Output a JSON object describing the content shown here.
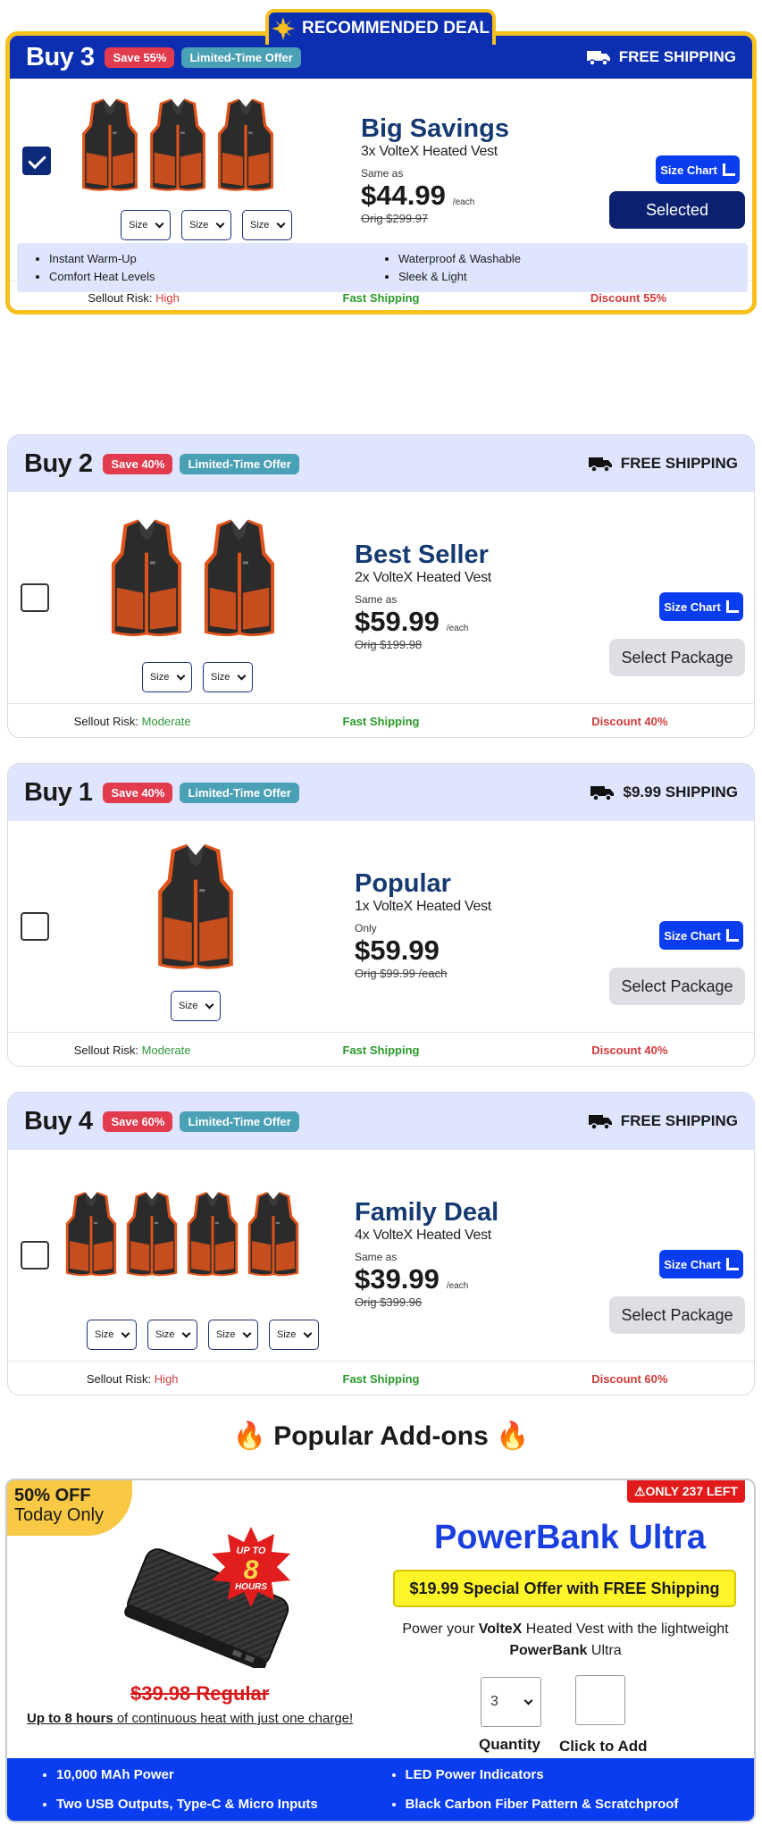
{
  "banner": {
    "label": "RECOMMENDED DEAL"
  },
  "packages": [
    {
      "buy": "Buy 3",
      "save": "Save 55%",
      "lto": "Limited-Time Offer",
      "shipping": "FREE SHIPPING",
      "title": "Big Savings",
      "product": "3x VolteX Heated Vest",
      "prefix": "Same as",
      "price": "$44.99",
      "each": "/each",
      "orig": "Orig $299.97",
      "size_chart": "Size Chart",
      "button": "Selected",
      "size": "Size",
      "features": [
        "Instant Warm-Up",
        "Waterproof & Washable",
        "Comfort Heat Levels",
        "Sleek & Light"
      ],
      "risk_label": "Sellout Risk:",
      "risk": "High",
      "fast": "Fast Shipping",
      "discount": "Discount 55%"
    },
    {
      "buy": "Buy 2",
      "save": "Save 40%",
      "lto": "Limited-Time Offer",
      "shipping": "FREE SHIPPING",
      "title": "Best Seller",
      "product": "2x VolteX Heated Vest",
      "prefix": "Same as",
      "price": "$59.99",
      "each": "/each",
      "orig": "Orig $199.98",
      "size_chart": "Size Chart",
      "button": "Select Package",
      "size": "Size",
      "risk_label": "Sellout Risk:",
      "risk": "Moderate",
      "fast": "Fast Shipping",
      "discount": "Discount 40%"
    },
    {
      "buy": "Buy 1",
      "save": "Save 40%",
      "lto": "Limited-Time Offer",
      "shipping": "$9.99 SHIPPING",
      "title": "Popular",
      "product": "1x VolteX Heated Vest",
      "prefix": "Only",
      "price": "$59.99",
      "orig": "Orig $99.99 /each",
      "size_chart": "Size Chart",
      "button": "Select Package",
      "size": "Size",
      "risk_label": "Sellout Risk:",
      "risk": "Moderate",
      "fast": "Fast Shipping",
      "discount": "Discount 40%"
    },
    {
      "buy": "Buy 4",
      "save": "Save 60%",
      "lto": "Limited-Time Offer",
      "shipping": "FREE SHIPPING",
      "title": "Family Deal",
      "product": "4x VolteX Heated Vest",
      "prefix": "Same as",
      "price": "$39.99",
      "each": "/each",
      "orig": "Orig $399.96",
      "size_chart": "Size Chart",
      "button": "Select Package",
      "size": "Size",
      "risk_label": "Sellout Risk:",
      "risk": "High",
      "fast": "Fast Shipping",
      "discount": "Discount 60%"
    }
  ],
  "addons": {
    "heading": "Popular Add-ons",
    "corner_top": "50% OFF",
    "corner_bottom": "Today Only",
    "stock_badge": "ONLY 237 LEFT",
    "starburst_top": "UP TO",
    "starburst_num": "8",
    "starburst_bottom": "HOURS",
    "title": "PowerBank Ultra",
    "offer": "$19.99 Special Offer with FREE Shipping",
    "desc_pre": "Power your ",
    "desc_brand": "VolteX",
    "desc_mid": " Heated Vest with the lightweight ",
    "desc_product_a": "PowerBank",
    "desc_product_b": " Ultra",
    "regular": "$39.98 Regular",
    "heat_bold": "Up to 8 hours",
    "heat_rest": " of continuous heat with just one charge!",
    "qty_value": "3",
    "qty_label": "Quantity",
    "add_label": "Click to Add",
    "features": [
      "10,000 MAh Power",
      "LED Power Indicators",
      "Two USB Outputs, Type-C & Micro Inputs",
      "Black Carbon Fiber Pattern & Scratchproof"
    ]
  },
  "colors": {
    "brand_blue": "#0b2fb0",
    "accent_yellow": "#f6c01f",
    "cta_blue": "#0a3df0",
    "vest_orange": "#e0541c"
  }
}
